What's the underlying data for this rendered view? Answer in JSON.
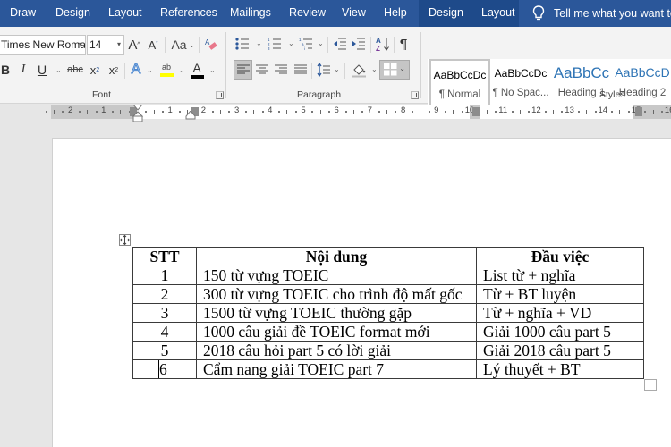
{
  "tabs": {
    "items": [
      {
        "label": "Draw"
      },
      {
        "label": "Design"
      },
      {
        "label": "Layout"
      },
      {
        "label": "References"
      },
      {
        "label": "Mailings"
      },
      {
        "label": "Review"
      },
      {
        "label": "View"
      },
      {
        "label": "Help"
      }
    ],
    "contextual": [
      {
        "label": "Design"
      },
      {
        "label": "Layout"
      }
    ],
    "tell_me": "Tell me what you want to",
    "colors": {
      "bar": "#2b579a",
      "contextual": "#1e4a8a"
    }
  },
  "ribbon": {
    "font": {
      "group_label": "Font",
      "font_name": "Times New Roma",
      "font_size": "14",
      "grow": "A",
      "shrink": "A",
      "change_case": "Aa",
      "bold": "B",
      "italic": "I",
      "underline": "U",
      "strikethrough": "abc",
      "subscript": "x",
      "superscript": "x",
      "text_effects": "A",
      "highlight": "ab",
      "font_color": "A",
      "highlight_color": "#ffff00",
      "font_color_value": "#000000"
    },
    "paragraph": {
      "group_label": "Paragraph"
    },
    "styles": {
      "group_label": "Styles",
      "items": [
        {
          "preview": "AaBbCcDc",
          "name": "¶ Normal",
          "active": true
        },
        {
          "preview": "AaBbCcDc",
          "name": "¶ No Spac...",
          "active": false
        },
        {
          "preview": "AaBbCc",
          "name": "Heading 1",
          "active": false
        },
        {
          "preview": "AaBbCcD",
          "name": "Heading 2",
          "active": false
        }
      ]
    }
  },
  "ruler": {
    "left_numbers": [
      "2",
      "1"
    ],
    "right_numbers": [
      "1",
      "2",
      "3",
      "4",
      "5",
      "6",
      "7",
      "8",
      "9",
      "10",
      "11",
      "12",
      "13",
      "14",
      "15",
      "16"
    ]
  },
  "document": {
    "table": {
      "headers": [
        "STT",
        "Nội dung",
        "Đầu việc"
      ],
      "rows": [
        [
          "1",
          "150 từ vựng TOEIC",
          "List từ + nghĩa"
        ],
        [
          "2",
          "300 từ vựng TOEIC cho trình độ mất gốc",
          "Từ + BT luyện"
        ],
        [
          "3",
          "1500 từ vựng TOEIC thường gặp",
          "Từ + nghĩa + VD"
        ],
        [
          "4",
          "1000 câu giải đề TOEIC format mới",
          "Giải 1000 câu part 5"
        ],
        [
          "5",
          "2018 câu hỏi part 5 có lời giải",
          "Giải 2018 câu part 5"
        ],
        [
          "6",
          "Cẩm nang giải TOEIC part 7",
          "Lý thuyết + BT"
        ]
      ]
    }
  }
}
